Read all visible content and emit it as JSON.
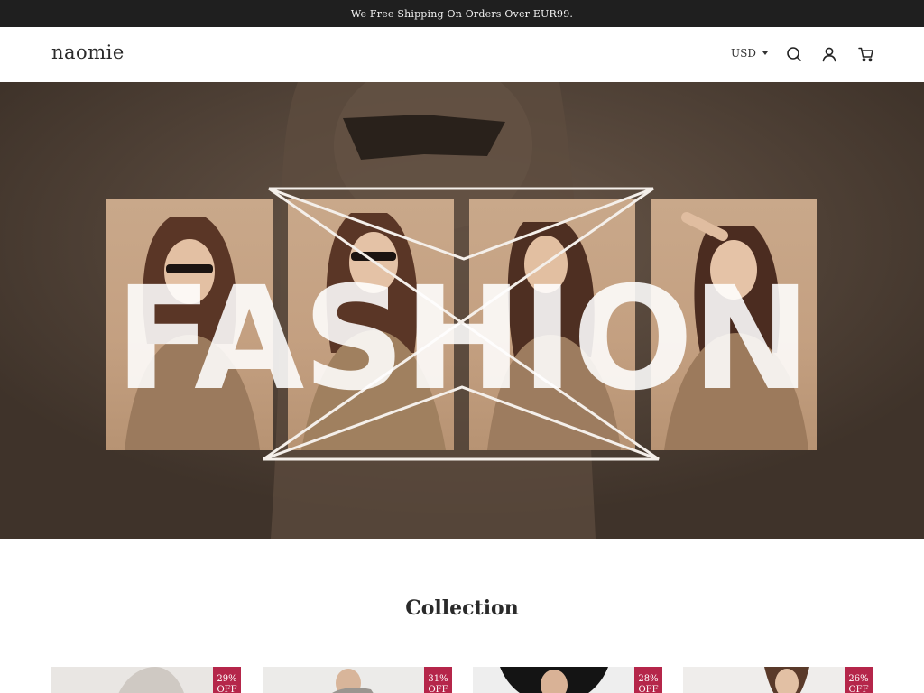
{
  "announcement": "We Free Shipping On Orders Over EUR99.",
  "header": {
    "logo": "naomie",
    "currency": "USD",
    "icons": [
      "search-icon",
      "account-icon",
      "cart-icon"
    ]
  },
  "hero": {
    "headline": "FASHION"
  },
  "collection": {
    "title": "Collection",
    "products": [
      {
        "discount": "29%",
        "off_label": "OFF"
      },
      {
        "discount": "31%",
        "off_label": "OFF"
      },
      {
        "discount": "28%",
        "off_label": "OFF"
      },
      {
        "discount": "26%",
        "off_label": "OFF"
      }
    ]
  },
  "colors": {
    "announcement_bg": "#1f1f1f",
    "hero_bg": "#4b3d33",
    "panel_tan": "#c9a88a",
    "badge": "#b5264a"
  }
}
